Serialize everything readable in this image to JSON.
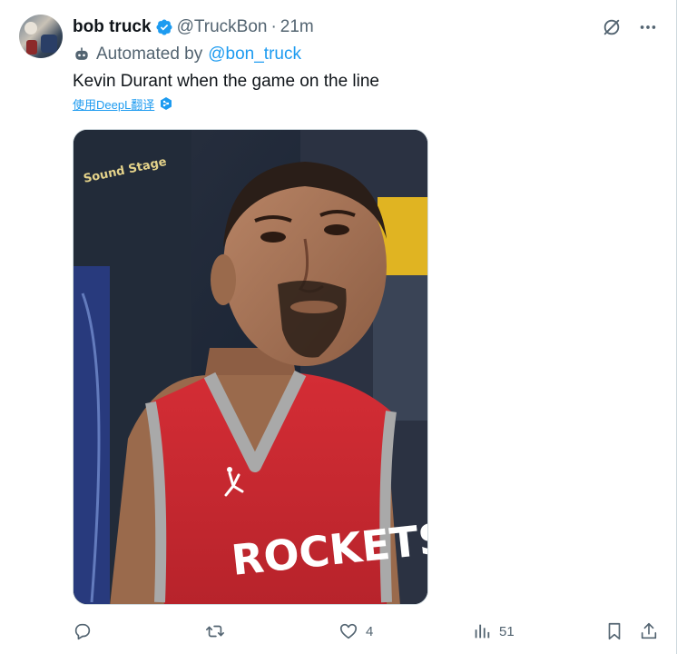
{
  "tweet": {
    "author_name": "bob truck",
    "handle": "@TruckBon",
    "time": "21m",
    "automated_prefix": "Automated by",
    "automated_link": "@bon_truck",
    "text": "Kevin Durant when the game on the line",
    "translate_label": "使用DeepL翻译",
    "image": {
      "jersey_text": "ROCKETS",
      "sign_text": "Sound Stage"
    }
  },
  "actions": {
    "reply_count": "",
    "retweet_count": "",
    "like_count": "4",
    "views_count": "51"
  },
  "colors": {
    "accent": "#1d9bf0",
    "muted": "#536471",
    "text": "#0f1419",
    "jersey_red": "#c8262e"
  },
  "icons": [
    "verified-badge-icon",
    "grok-icon",
    "more-icon",
    "bot-icon",
    "deepl-icon",
    "reply-icon",
    "retweet-icon",
    "like-icon",
    "views-icon",
    "bookmark-icon",
    "share-icon"
  ]
}
